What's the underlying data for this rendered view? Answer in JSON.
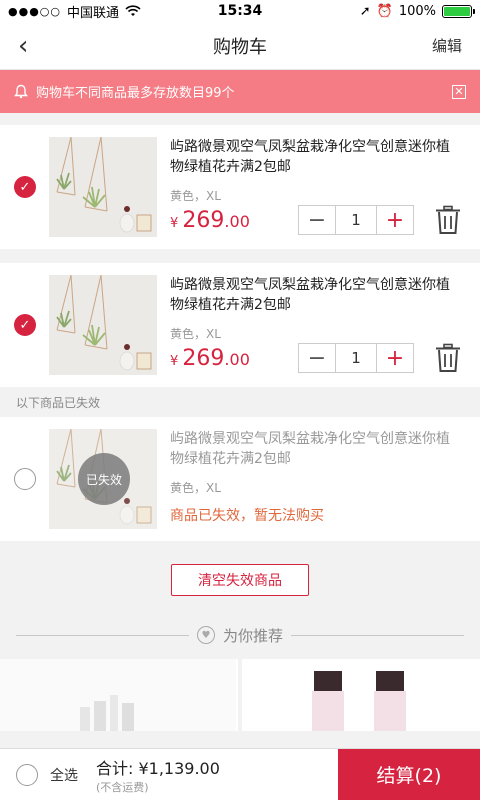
{
  "status_bar": {
    "carrier": "中国联通",
    "time": "15:34",
    "battery": "100%",
    "signal_dots": "●●●○○"
  },
  "nav": {
    "back_icon": "‹",
    "title": "购物车",
    "edit_label": "编辑"
  },
  "notice": {
    "text": "购物车不同商品最多存放数目99个",
    "close_icon": "✕"
  },
  "cart_items": [
    {
      "checked": true,
      "title": "屿路微景观空气凤梨盆栽净化空气创意迷你植物绿植花卉满2包邮",
      "spec": "黄色，XL",
      "currency": "¥",
      "price_int": "269",
      "price_dec": ".00",
      "quantity": "1"
    },
    {
      "checked": true,
      "title": "屿路微景观空气凤梨盆栽净化空气创意迷你植物绿植花卉满2包邮",
      "spec": "黄色，XL",
      "currency": "¥",
      "price_int": "269",
      "price_dec": ".00",
      "quantity": "1"
    }
  ],
  "expired_section": {
    "label": "以下商品已失效",
    "item": {
      "badge": "已失效",
      "title": "屿路微景观空气凤梨盆栽净化空气创意迷你植物绿植花卉满2包邮",
      "spec": "黄色，XL",
      "message": "商品已失效，暂无法购买"
    },
    "clear_button": "清空失效商品"
  },
  "recommend": {
    "title": "为你推荐"
  },
  "bottom_bar": {
    "select_all": "全选",
    "total_label": "合计: ¥1,139.00",
    "total_note": "(不含运费)",
    "checkout": "结算(2)"
  },
  "colors": {
    "accent": "#d6233f",
    "notice_bg": "#f57c84",
    "expired_msg": "#e0683d"
  }
}
